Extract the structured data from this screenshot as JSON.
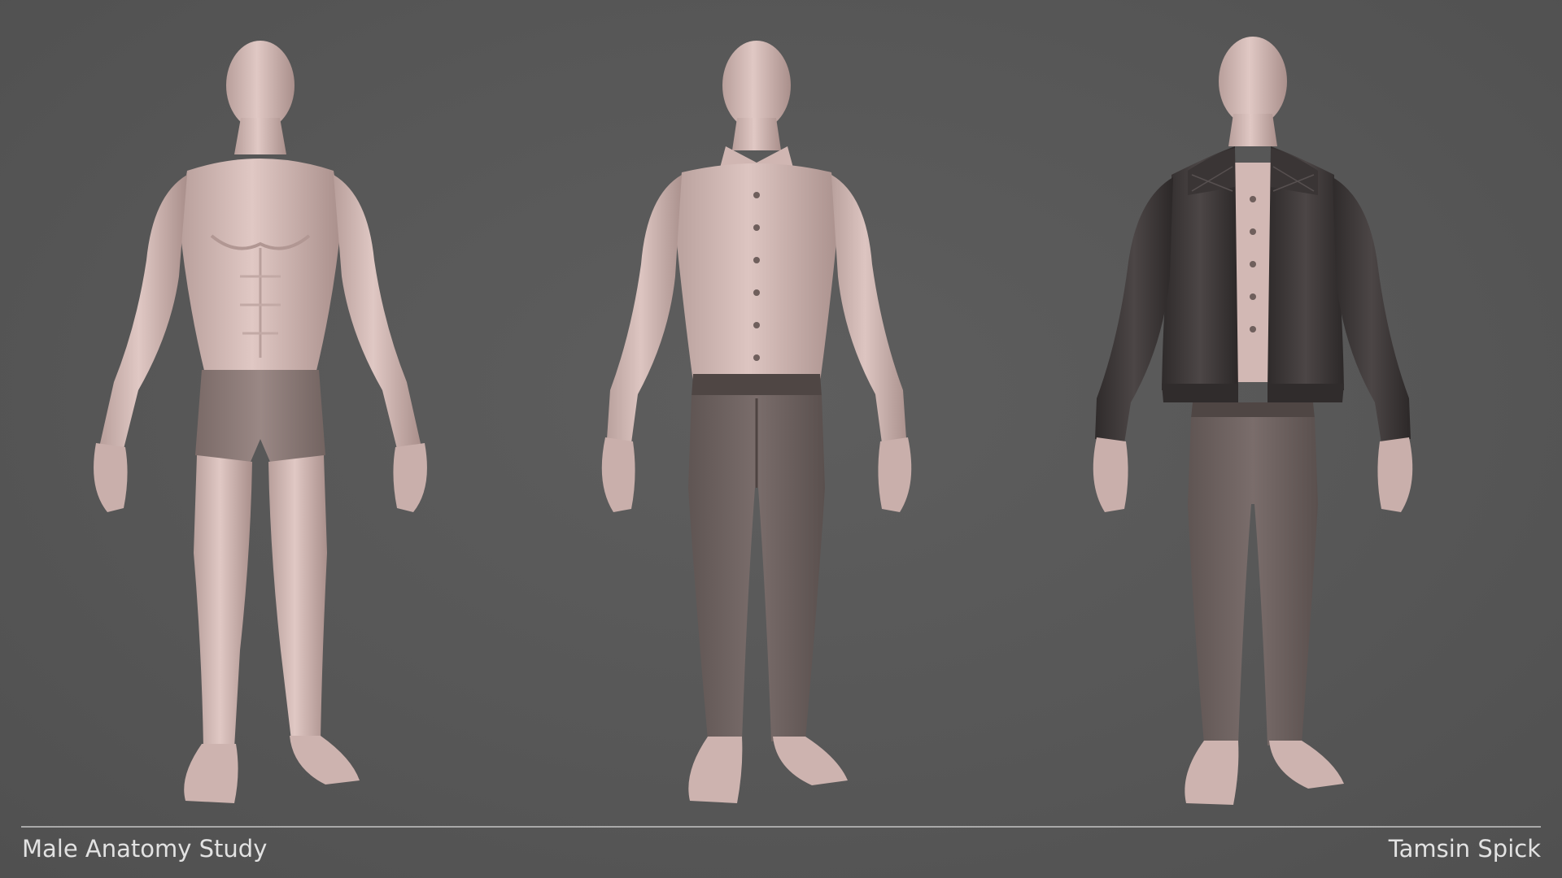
{
  "footer": {
    "title": "Male Anatomy Study",
    "author": "Tamsin Spick"
  },
  "figures": [
    {
      "name": "base-body",
      "outfit": "underwear"
    },
    {
      "name": "shirt-and-trousers",
      "outfit": "shirt-trousers"
    },
    {
      "name": "jacket-outfit",
      "outfit": "jacket-shirt-trousers"
    }
  ],
  "colors": {
    "background": "#575757",
    "skin": "#d6bcb8",
    "skin_shadow": "#a88f8c",
    "shirt": "#d4bab6",
    "trousers": "#6e6260",
    "underwear": "#8c7a77",
    "jacket": "#3f3a3a",
    "divider": "#a9a9a9",
    "caption_text": "#e2e2e2"
  }
}
